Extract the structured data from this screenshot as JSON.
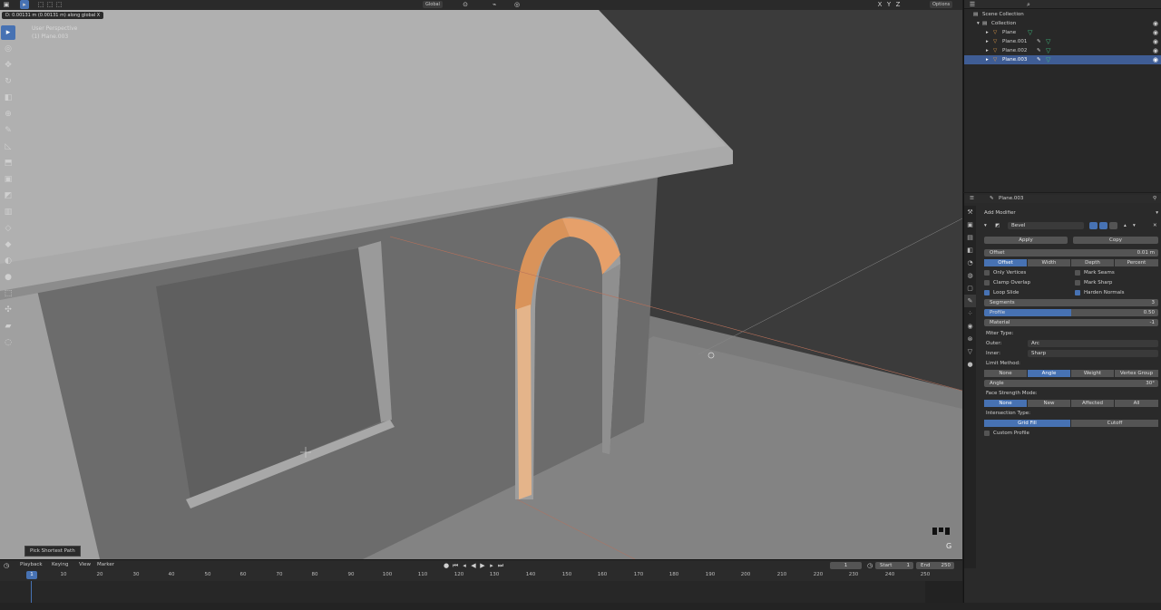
{
  "viewport": {
    "operator_text": "D: 0.00131 m (0.00131 m) along global X",
    "view_name": "User Perspective",
    "object_name": "(1) Plane.003",
    "transform_orientation": "Global",
    "options_label": "Options",
    "pick_hint": "Pick Shortest Path",
    "gizmo_letter": "G"
  },
  "outliner": {
    "scene_collection": "Scene Collection",
    "collection": "Collection",
    "objects": [
      "Plane",
      "Plane.001",
      "Plane.002",
      "Plane.003"
    ]
  },
  "properties": {
    "object_name": "Plane.003",
    "add_modifier": "Add Modifier",
    "modifier_name": "Bevel",
    "apply": "Apply",
    "copy": "Copy",
    "offset_label": "Offset",
    "offset_value": "0.01 m",
    "width_types": [
      "Offset",
      "Width",
      "Depth",
      "Percent"
    ],
    "width_type_selected": 0,
    "checks_left": [
      {
        "label": "Only Vertices",
        "on": false
      },
      {
        "label": "Clamp Overlap",
        "on": false
      },
      {
        "label": "Loop Slide",
        "on": true
      }
    ],
    "checks_right": [
      {
        "label": "Mark Seams",
        "on": false
      },
      {
        "label": "Mark Sharp",
        "on": false
      },
      {
        "label": "Harden Normals",
        "on": true
      }
    ],
    "segments_label": "Segments",
    "segments_value": "3",
    "profile_label": "Profile",
    "profile_value": "0.50",
    "profile_fill": 0.5,
    "material_label": "Material",
    "material_value": "-1",
    "miter_type": "Miter Type:",
    "outer_label": "Outer:",
    "outer_value": "Arc",
    "inner_label": "Inner:",
    "inner_value": "Sharp",
    "limit_method": "Limit Method:",
    "limit_options": [
      "None",
      "Angle",
      "Weight",
      "Vertex Group"
    ],
    "limit_selected": 1,
    "angle_label": "Angle",
    "angle_value": "30°",
    "face_strength": "Face Strength Mode:",
    "face_options": [
      "None",
      "New",
      "Affected",
      "All"
    ],
    "face_selected": 0,
    "intersection": "Intersection Type:",
    "intersection_options": [
      "Grid Fill",
      "Cutoff"
    ],
    "intersection_selected": 0,
    "custom_profile": "Custom Profile"
  },
  "timeline": {
    "menus": [
      "Playback",
      "Keying",
      "View",
      "Marker"
    ],
    "current_frame": "1",
    "start_label": "Start",
    "start_value": "1",
    "end_label": "End",
    "end_value": "250",
    "ticks": [
      "10",
      "20",
      "30",
      "40",
      "50",
      "60",
      "70",
      "80",
      "90",
      "100",
      "110",
      "120",
      "130",
      "140",
      "150",
      "160",
      "170",
      "180",
      "190",
      "200",
      "210",
      "220",
      "230",
      "240",
      "250"
    ]
  },
  "colors": {
    "accent": "#4772b3",
    "selected_edge": "#e09a55",
    "viewport_bg": "#3d3d3d"
  }
}
